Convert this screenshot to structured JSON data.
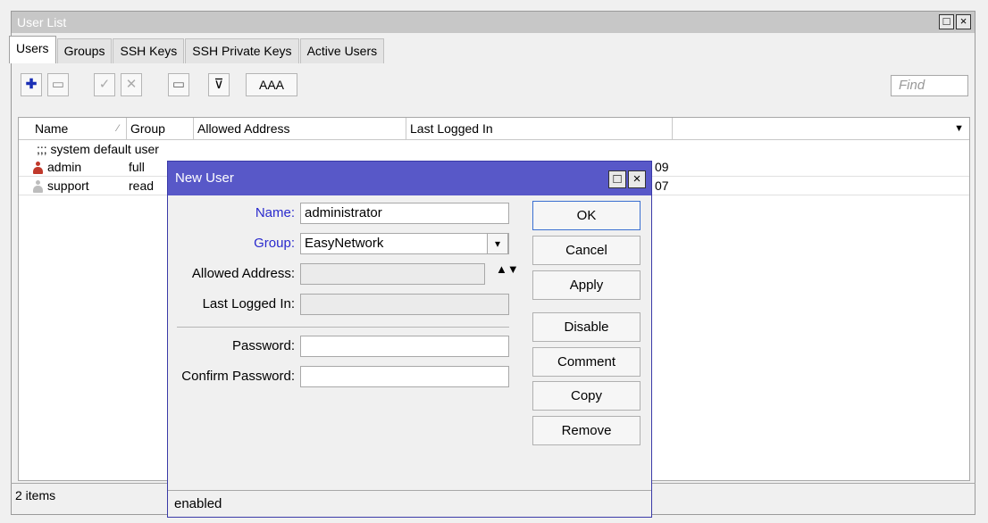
{
  "window": {
    "title": "User List",
    "restore_glyph": "□",
    "close_glyph": "×"
  },
  "tabs": [
    {
      "label": "Users",
      "active": true
    },
    {
      "label": "Groups"
    },
    {
      "label": "SSH Keys"
    },
    {
      "label": "SSH Private Keys"
    },
    {
      "label": "Active Users"
    }
  ],
  "toolbar": {
    "add_glyph": "✚",
    "remove_glyph": "▭",
    "enable_glyph": "✓",
    "disable_glyph": "✕",
    "comment_glyph": "▭",
    "filter_glyph": "⊽",
    "aaa_label": "AAA",
    "find_placeholder": "Find"
  },
  "table": {
    "columns": [
      "Name",
      "Group",
      "Allowed Address",
      "Last Logged In"
    ],
    "sort_glyph": "⁄",
    "dropdown_glyph": "▼",
    "section_label": ";;; system default user",
    "rows": [
      {
        "name": "admin",
        "group": "full",
        "last_suffix": "09",
        "icon_color": "#c0392b"
      },
      {
        "name": "support",
        "group": "read",
        "last_suffix": "07",
        "icon_color": "#bdbdbd"
      }
    ],
    "count": "2 items"
  },
  "dialog": {
    "title": "New User",
    "restore_glyph": "□",
    "close_glyph": "×",
    "name_label": "Name:",
    "name_value": "administrator",
    "group_label": "Group:",
    "group_value": "EasyNetwork",
    "group_dropdown_glyph": "▾",
    "allowed_label": "Allowed Address:",
    "allowed_updown_glyph": "▲▼",
    "last_label": "Last Logged In:",
    "password_label": "Password:",
    "confirm_label": "Confirm Password:",
    "buttons": {
      "ok": "OK",
      "cancel": "Cancel",
      "apply": "Apply",
      "disable": "Disable",
      "comment": "Comment",
      "copy": "Copy",
      "remove": "Remove"
    },
    "status": "enabled"
  }
}
